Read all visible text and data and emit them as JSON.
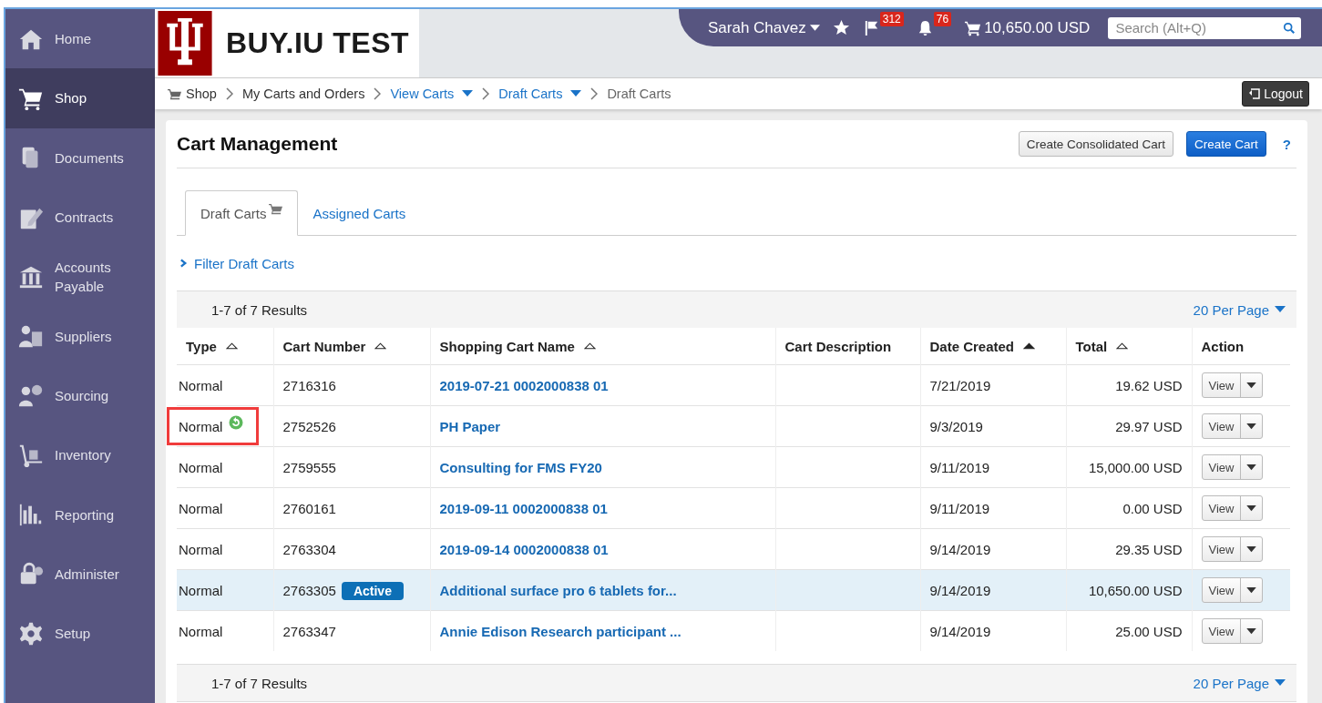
{
  "sidebar": {
    "items": [
      {
        "label": "Home",
        "kind": "home",
        "selected": false
      },
      {
        "label": "Shop",
        "kind": "cart",
        "selected": true
      },
      {
        "label": "Documents",
        "kind": "documents",
        "selected": false
      },
      {
        "label": "Contracts",
        "kind": "contract",
        "selected": false
      },
      {
        "label": "Accounts Payable",
        "kind": "bank",
        "selected": false
      },
      {
        "label": "Suppliers",
        "kind": "supplier",
        "selected": false
      },
      {
        "label": "Sourcing",
        "kind": "sourcing",
        "selected": false
      },
      {
        "label": "Inventory",
        "kind": "dolly",
        "selected": false
      },
      {
        "label": "Reporting",
        "kind": "chart",
        "selected": false
      },
      {
        "label": "Administer",
        "kind": "lock",
        "selected": false
      },
      {
        "label": "Setup",
        "kind": "gear",
        "selected": false
      }
    ]
  },
  "logo": {
    "title": "BUY.IU TEST"
  },
  "user_bar": {
    "user": "Sarah Chavez",
    "flag_count": "312",
    "bell_count": "76",
    "cart_total": "10,650.00 USD",
    "search": {
      "placeholder": "Search (Alt+Q)"
    }
  },
  "breadcrumb": [
    {
      "label": "Shop",
      "kind": "plain"
    },
    {
      "label": "My Carts and Orders",
      "kind": "plain"
    },
    {
      "label": "View Carts",
      "kind": "menu"
    },
    {
      "label": "Draft Carts",
      "kind": "menu"
    },
    {
      "label": "Draft Carts",
      "kind": "current"
    }
  ],
  "logout": "Logout",
  "page": {
    "title": "Cart Management",
    "buttons": [
      {
        "label": "Create Consolidated Cart",
        "kind": "secondary"
      },
      {
        "label": "Create Cart",
        "kind": "primary"
      }
    ],
    "help": "?"
  },
  "tabs": [
    {
      "label": "Draft Carts",
      "selected": true,
      "cart_icon": true
    },
    {
      "label": "Assigned Carts",
      "selected": false,
      "cart_icon": false
    }
  ],
  "filter": {
    "label": "Filter Draft Carts",
    "expanded": false
  },
  "results_top": {
    "count": "1-7 of 7 Results",
    "per_page": "20 Per Page"
  },
  "table": {
    "columns": [
      {
        "label": "Type",
        "sortable": true,
        "sorted": false
      },
      {
        "label": "Cart Number",
        "sortable": true,
        "sorted": false
      },
      {
        "label": "Shopping Cart Name",
        "sortable": true,
        "sorted": false
      },
      {
        "label": "Cart Description",
        "sortable": false
      },
      {
        "label": "Date Created",
        "sortable": true,
        "sorted": true
      },
      {
        "label": "Total",
        "sortable": true,
        "sorted": false
      },
      {
        "label": "Action",
        "sortable": false
      }
    ],
    "rows": [
      {
        "type": "Normal",
        "recurring": false,
        "annotated": false,
        "number": "2716316",
        "name": "2019-07-21 0002000838 01",
        "date": "7/21/2019",
        "total": "19.62 USD",
        "action": "View",
        "highlighted": false
      },
      {
        "type": "Normal",
        "recurring": true,
        "annotated": true,
        "number": "2752526",
        "name": "PH Paper",
        "date": "9/3/2019",
        "total": "29.97 USD",
        "action": "View",
        "highlighted": false
      },
      {
        "type": "Normal",
        "recurring": false,
        "annotated": false,
        "number": "2759555",
        "name": "Consulting for FMS FY20",
        "date": "9/11/2019",
        "total": "15,000.00 USD",
        "action": "View",
        "highlighted": false
      },
      {
        "type": "Normal",
        "recurring": false,
        "annotated": false,
        "number": "2760161",
        "name": "2019-09-11 0002000838 01",
        "date": "9/11/2019",
        "total": "0.00 USD",
        "action": "View",
        "highlighted": false
      },
      {
        "type": "Normal",
        "recurring": false,
        "annotated": false,
        "number": "2763304",
        "name": "2019-09-14 0002000838 01",
        "date": "9/14/2019",
        "total": "29.35 USD",
        "action": "View",
        "highlighted": false
      },
      {
        "type": "Normal",
        "recurring": false,
        "annotated": false,
        "number": "2763305",
        "badge": "Active",
        "name": "Additional surface pro 6 tablets for...",
        "date": "9/14/2019",
        "total": "10,650.00 USD",
        "action": "View",
        "highlighted": true
      },
      {
        "type": "Normal",
        "recurring": false,
        "annotated": false,
        "number": "2763347",
        "name": "Annie Edison Research participant ...",
        "date": "9/14/2019",
        "total": "25.00 USD",
        "action": "View",
        "highlighted": false
      }
    ]
  },
  "results_bottom": {
    "count": "1-7 of 7 Results",
    "per_page": "20 Per Page"
  }
}
